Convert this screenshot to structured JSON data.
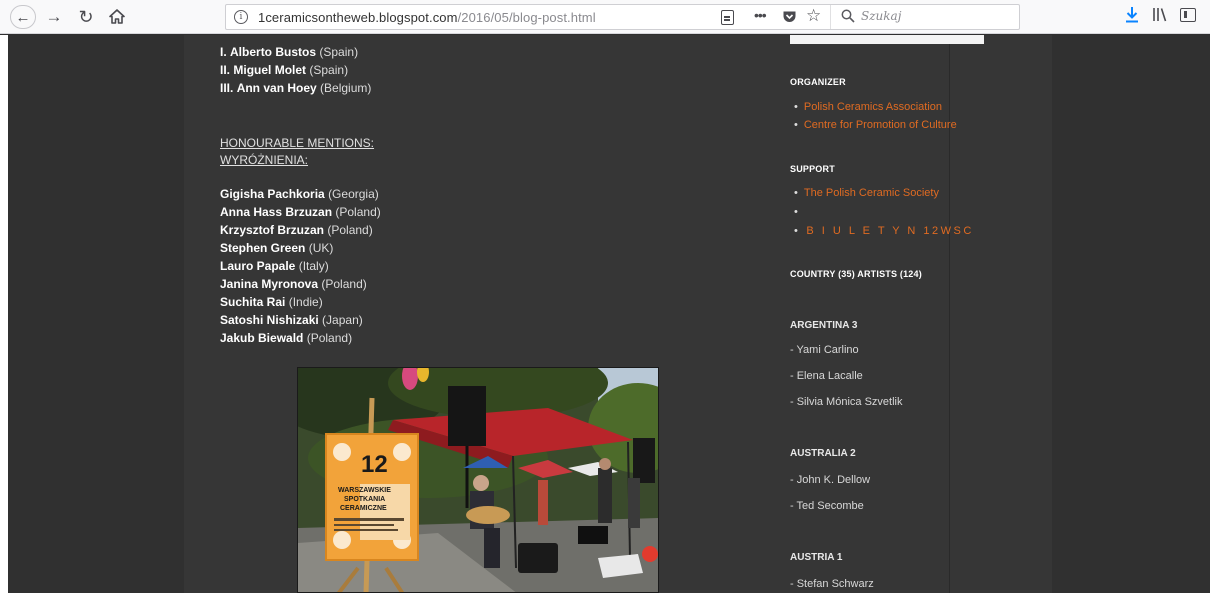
{
  "browser": {
    "url_main": "1ceramicsontheweb.blogspot.com",
    "url_path": "/2016/05/blog-post.html",
    "search_placeholder": "Szukaj"
  },
  "winners": [
    {
      "rank": "I.",
      "name": "Alberto Bustos",
      "country": "(Spain)"
    },
    {
      "rank": "II.",
      "name": "Miguel Molet",
      "country": "(Spain)"
    },
    {
      "rank": "III.",
      "name": "Ann van Hoey",
      "country": "(Belgium)"
    }
  ],
  "honourable": {
    "heading_en": "HONOURABLE MENTIONS:",
    "heading_pl": "WYRÓŻNIENIA:",
    "entries": [
      {
        "name": "Gigisha Pachkoria",
        "country": "(Georgia)"
      },
      {
        "name": "Anna Hass Brzuzan",
        "country": "(Poland)"
      },
      {
        "name": "Krzysztof Brzuzan",
        "country": "(Poland)"
      },
      {
        "name": "Stephen Green",
        "country": "(UK)"
      },
      {
        "name": "Lauro Papale",
        "country": "(Italy)"
      },
      {
        "name": "Janina Myronova",
        "country": "(Poland)"
      },
      {
        "name": "Suchita Rai",
        "country": "(Indie)"
      },
      {
        "name": "Satoshi Nishizaki",
        "country": "(Japan)"
      },
      {
        "name": "Jakub Biewald",
        "country": " (Poland)"
      }
    ]
  },
  "photo": {
    "poster_number": "12",
    "poster_line1": "WARSZAWSKIE",
    "poster_line2": "SPOTKANIA",
    "poster_line3": "CERAMICZNE"
  },
  "sidebar": {
    "organizer_heading": "ORGANIZER",
    "organizer_links": [
      "Polish Ceramics Association",
      "Centre for Promotion of Culture"
    ],
    "support_heading": "SUPPORT",
    "support_links": [
      "The Polish Ceramic Society",
      "",
      "B I U L E T Y N 12WSC"
    ],
    "country_heading": "COUNTRY (35) ARTISTS (124)",
    "countries": [
      {
        "name": "ARGENTINA 3",
        "artists": [
          "- Yami Carlino",
          "- Elena Lacalle",
          "- Silvia Mónica Szvetlik"
        ]
      },
      {
        "name": "AUSTRALIA 2",
        "artists": [
          "- John K. Dellow",
          "- Ted Secombe"
        ]
      },
      {
        "name": "AUSTRIA 1",
        "artists": [
          "- Stefan Schwarz"
        ]
      }
    ]
  }
}
